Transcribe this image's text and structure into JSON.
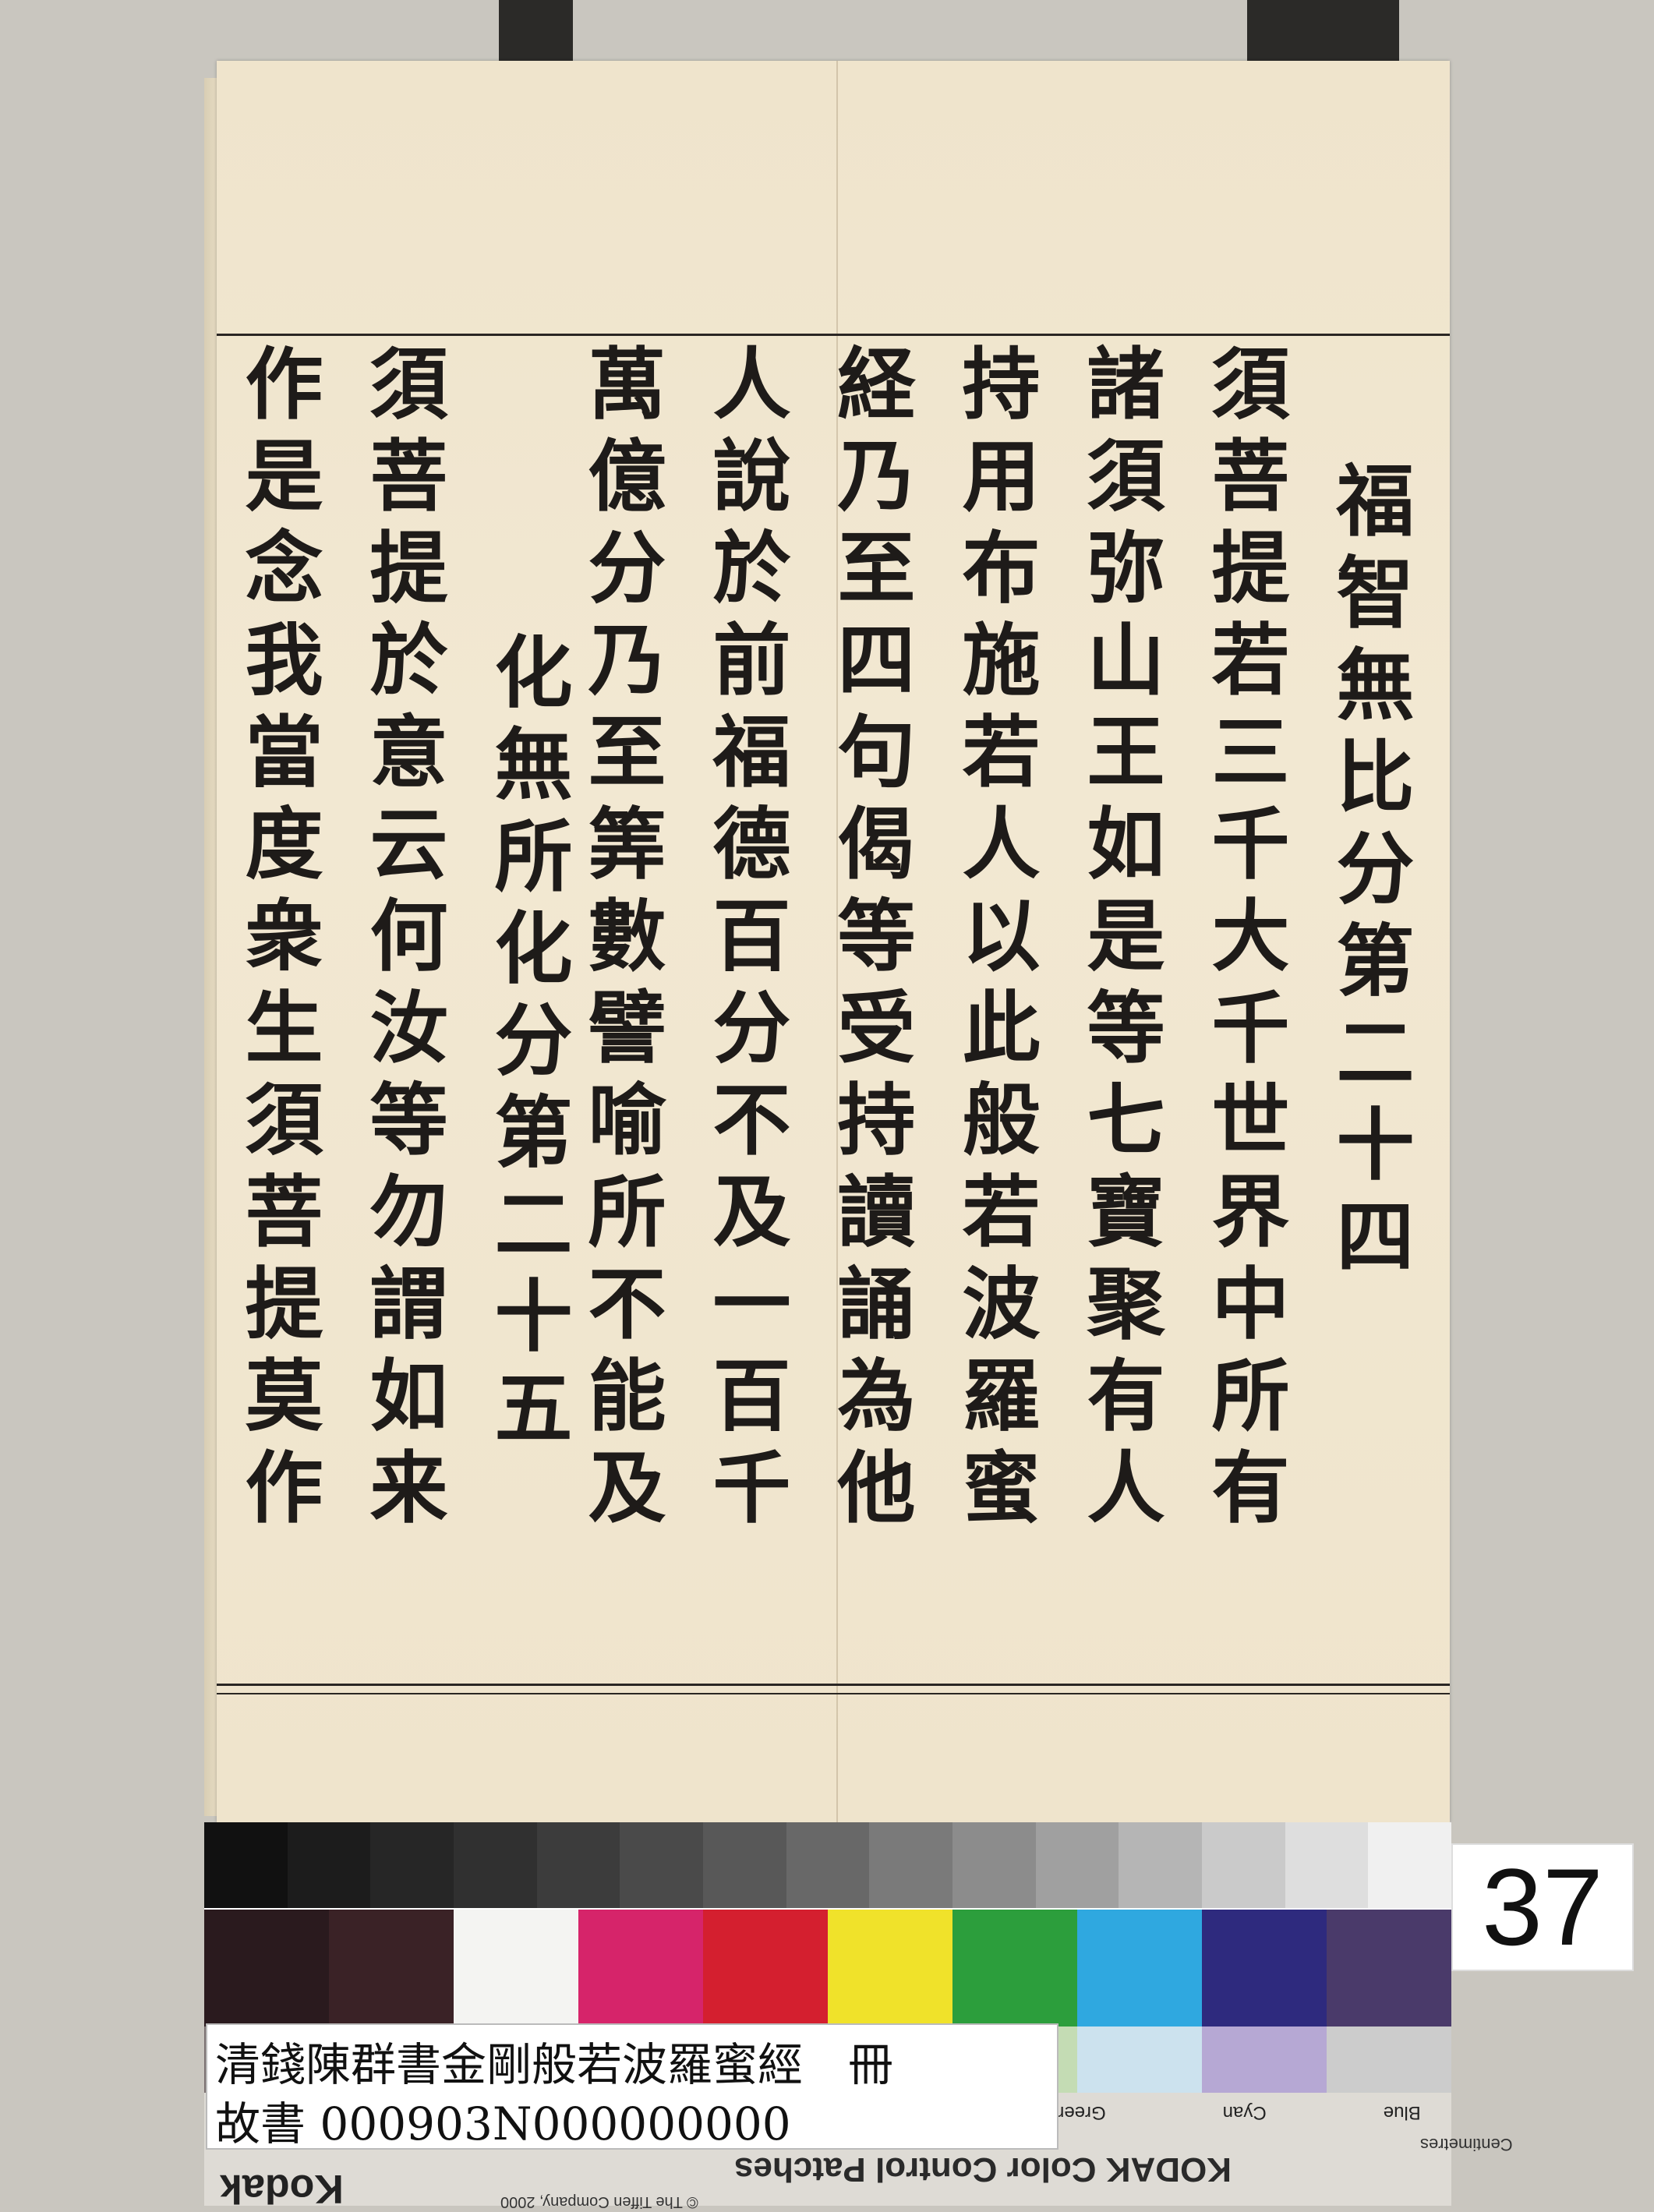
{
  "document": {
    "heading_24": "福智無比分第二十四",
    "heading_25": "化無所化分第二十五",
    "columns": [
      "須菩提若三千大千世界中所有",
      "諸須弥山王如是等七寶聚有人",
      "持用布施若人以此般若波羅蜜",
      "経乃至四句偈等受持讀誦為他",
      "人說於前福德百分不及一百千",
      "萬億分乃至筭數譬喻所不能及",
      "須菩提於意云何汝等勿謂如来",
      "作是念我當度衆生須菩提莫作"
    ]
  },
  "color_target": {
    "title": "KODAK Color Control Patches",
    "company": "© The Tiffen Company, 2000",
    "logo": "Kodak",
    "unit": "Centimetres",
    "color_names": [
      "Blue",
      "Cyan",
      "Green"
    ],
    "gray_patches": [
      "#111111",
      "#1c1c1c",
      "#262626",
      "#303030",
      "#3c3c3c",
      "#4a4a4a",
      "#585858",
      "#686868",
      "#7a7a7a",
      "#8c8c8c",
      "#a0a0a0",
      "#b5b5b5",
      "#cacaca",
      "#dedede",
      "#f0f0f0"
    ],
    "color_patches": [
      "#2a1a1e",
      "#3a2226",
      "#f4f4f2",
      "#d6246a",
      "#d41f2f",
      "#f0e22a",
      "#2c9e3c",
      "#2fa8e0",
      "#2e2a7e",
      "#4a3a6a"
    ],
    "light_patches": [
      "#7a7070",
      "#b89a8e",
      "#e8e4de",
      "#f0b6c8",
      "#f0a690",
      "#f5ecb0",
      "#c4dcb4",
      "#cce2ee",
      "#b6a8d4",
      "#cccccc"
    ]
  },
  "page_number": "37",
  "label": {
    "line1": "清錢陳群書金剛般若波羅蜜經　冊",
    "line2": "故書 000903N000000000"
  }
}
